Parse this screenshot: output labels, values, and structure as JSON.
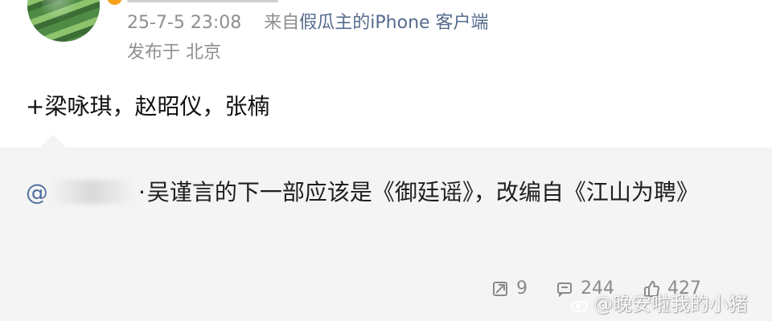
{
  "header": {
    "timestamp": "25-7-5 23:08",
    "source_prefix": "来自",
    "source_client": "假瓜主的iPhone 客户端",
    "location": "发布于 北京",
    "verified_mark": "v"
  },
  "post": {
    "text": "+梁咏琪，赵昭仪，张楠"
  },
  "repost": {
    "mention_prefix": "@",
    "separator": "·",
    "content": "吴谨言的下一部应该是《御廷谣》，改编自《江山为聘》"
  },
  "actions": {
    "repost_count": "9",
    "comment_count": "244",
    "like_count": "427"
  },
  "watermark": {
    "text": "@晚安啦我的小猪"
  },
  "colors": {
    "background": "#ffffff",
    "repost_background": "#f4f4f4",
    "meta_gray": "#8f8f8f",
    "link_blue": "#556b8d",
    "badge_orange": "#f7a11a"
  },
  "icons": {
    "repost": "share-icon",
    "comment": "comment-icon",
    "like": "like-icon",
    "watermark": "weibo-logo-icon",
    "verified": "verified-badge-icon"
  }
}
